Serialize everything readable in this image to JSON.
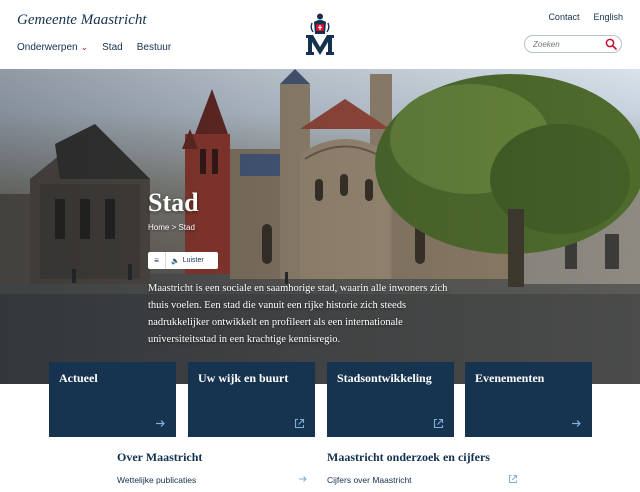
{
  "header": {
    "brand": "Gemeente Maastricht",
    "nav": [
      {
        "label": "Onderwerpen",
        "has_dropdown": true
      },
      {
        "label": "Stad"
      },
      {
        "label": "Bestuur"
      }
    ],
    "top_links": [
      "Contact",
      "English"
    ],
    "search_placeholder": "Zoeken",
    "logo_icon": "maastricht-crest-icon"
  },
  "hero": {
    "title": "Stad",
    "breadcrumb": "Home > Stad",
    "listen_label": "Luister",
    "intro": "Maastricht is een sociale en saamhorige stad, waarin alle inwoners zich thuis voelen. Een stad die vanuit een rijke historie zich steeds nadrukkelijker ontwikkelt en profileert als een internationale universiteitsstad in een krachtige kennisregio."
  },
  "tiles": [
    {
      "title": "Actueel",
      "icon": "arrow-right-icon"
    },
    {
      "title": "Uw wijk en buurt",
      "icon": "external-link-icon"
    },
    {
      "title": "Stadsontwikkeling",
      "icon": "external-link-icon"
    },
    {
      "title": "Evenementen",
      "icon": "arrow-right-icon"
    }
  ],
  "sections": [
    {
      "heading": "Over Maastricht",
      "link": "Wettelijke publicaties",
      "icon": "arrow-right-icon"
    },
    {
      "heading": "Maastricht onderzoek en cijfers",
      "link": "Cijfers over Maastricht",
      "icon": "external-link-icon"
    }
  ],
  "colors": {
    "brand_navy": "#14314f",
    "tile_bg": "#16344f",
    "accent_red": "#c8102e",
    "accent_light_blue": "#7fb0d8"
  }
}
